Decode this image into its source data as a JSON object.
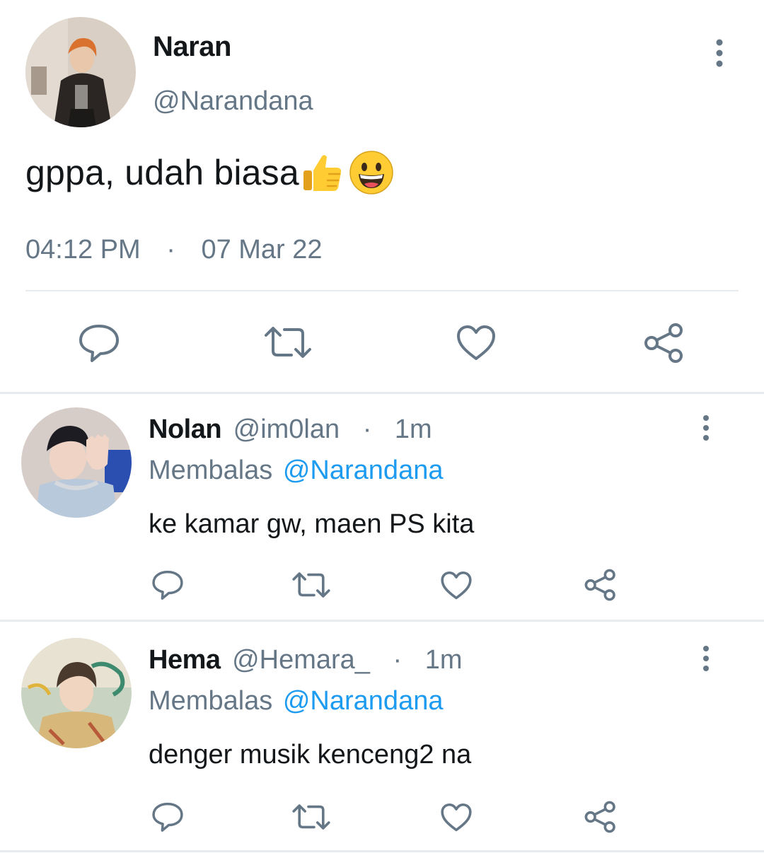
{
  "tweet": {
    "author_name": "Naran",
    "author_handle": "@Narandana",
    "text": "gppa, udah biasa",
    "emojis": [
      "thumbs-up-emoji",
      "grinning-face-emoji"
    ],
    "time": "04:12 PM",
    "separator": "·",
    "date": "07 Mar 22",
    "actions": [
      "reply-icon",
      "retweet-icon",
      "like-icon",
      "share-icon"
    ]
  },
  "replies": [
    {
      "name": "Nolan",
      "handle": "@im0lan",
      "separator": "·",
      "time": "1m",
      "replying_label": "Membalas",
      "replying_to": "@Narandana",
      "text": "ke kamar gw, maen PS kita"
    },
    {
      "name": "Hema",
      "handle": "@Hemara_",
      "separator": "·",
      "time": "1m",
      "replying_label": "Membalas",
      "replying_to": "@Narandana",
      "text": "denger musik kenceng2 na"
    }
  ],
  "colors": {
    "text": "#14171a",
    "muted": "#657786",
    "link": "#1d9bf0",
    "divider": "#e6ecf0",
    "icon": "#657786"
  }
}
